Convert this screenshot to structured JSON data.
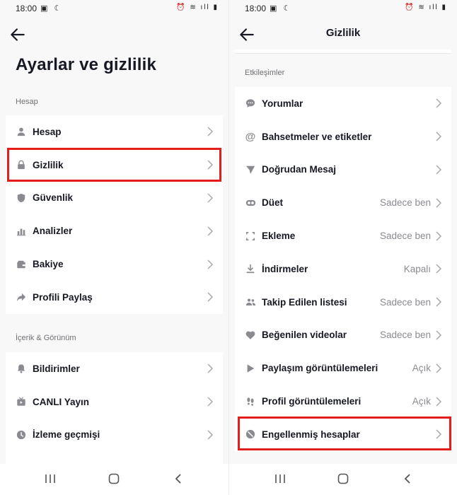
{
  "status": {
    "time": "18:00"
  },
  "left": {
    "title": "Ayarlar ve gizlilik",
    "sections": [
      {
        "label": "Hesap",
        "items": [
          {
            "label": "Hesap",
            "icon": "person-icon"
          },
          {
            "label": "Gizlilik",
            "icon": "lock-icon"
          },
          {
            "label": "Güvenlik",
            "icon": "shield-icon"
          },
          {
            "label": "Analizler",
            "icon": "bar-chart-icon"
          },
          {
            "label": "Bakiye",
            "icon": "wallet-icon"
          },
          {
            "label": "Profili Paylaş",
            "icon": "share-icon"
          }
        ]
      },
      {
        "label": "İçerik & Görünüm",
        "items": [
          {
            "label": "Bildirimler",
            "icon": "bell-icon"
          },
          {
            "label": "CANLI Yayın",
            "icon": "live-tv-icon"
          },
          {
            "label": "İzleme geçmişi",
            "icon": "clock-icon"
          }
        ]
      }
    ]
  },
  "right": {
    "title": "Gizlilik",
    "section": "Etkileşimler",
    "items": [
      {
        "label": "Yorumlar",
        "value": "",
        "icon": "comment-icon"
      },
      {
        "label": "Bahsetmeler ve etiketler",
        "value": "",
        "icon": "at-sign-icon"
      },
      {
        "label": "Doğrudan Mesaj",
        "value": "",
        "icon": "send-icon"
      },
      {
        "label": "Düet",
        "value": "Sadece ben",
        "icon": "duet-icon"
      },
      {
        "label": "Ekleme",
        "value": "Sadece ben",
        "icon": "stitch-icon"
      },
      {
        "label": "İndirmeler",
        "value": "Kapalı",
        "icon": "download-icon"
      },
      {
        "label": "Takip Edilen listesi",
        "value": "Sadece ben",
        "icon": "people-icon"
      },
      {
        "label": "Beğenilen videolar",
        "value": "Sadece ben",
        "icon": "heart-icon"
      },
      {
        "label": "Paylaşım görüntülemeleri",
        "value": "Açık",
        "icon": "play-icon"
      },
      {
        "label": "Profil görüntülemeleri",
        "value": "Açık",
        "icon": "footprints-icon"
      },
      {
        "label": "Engellenmiş hesaplar",
        "value": "",
        "icon": "block-icon"
      }
    ]
  },
  "colors": {
    "highlight": "#e31c1c",
    "background": "#f8f8f8",
    "text": "#161823",
    "secondary": "#8a8b91"
  }
}
